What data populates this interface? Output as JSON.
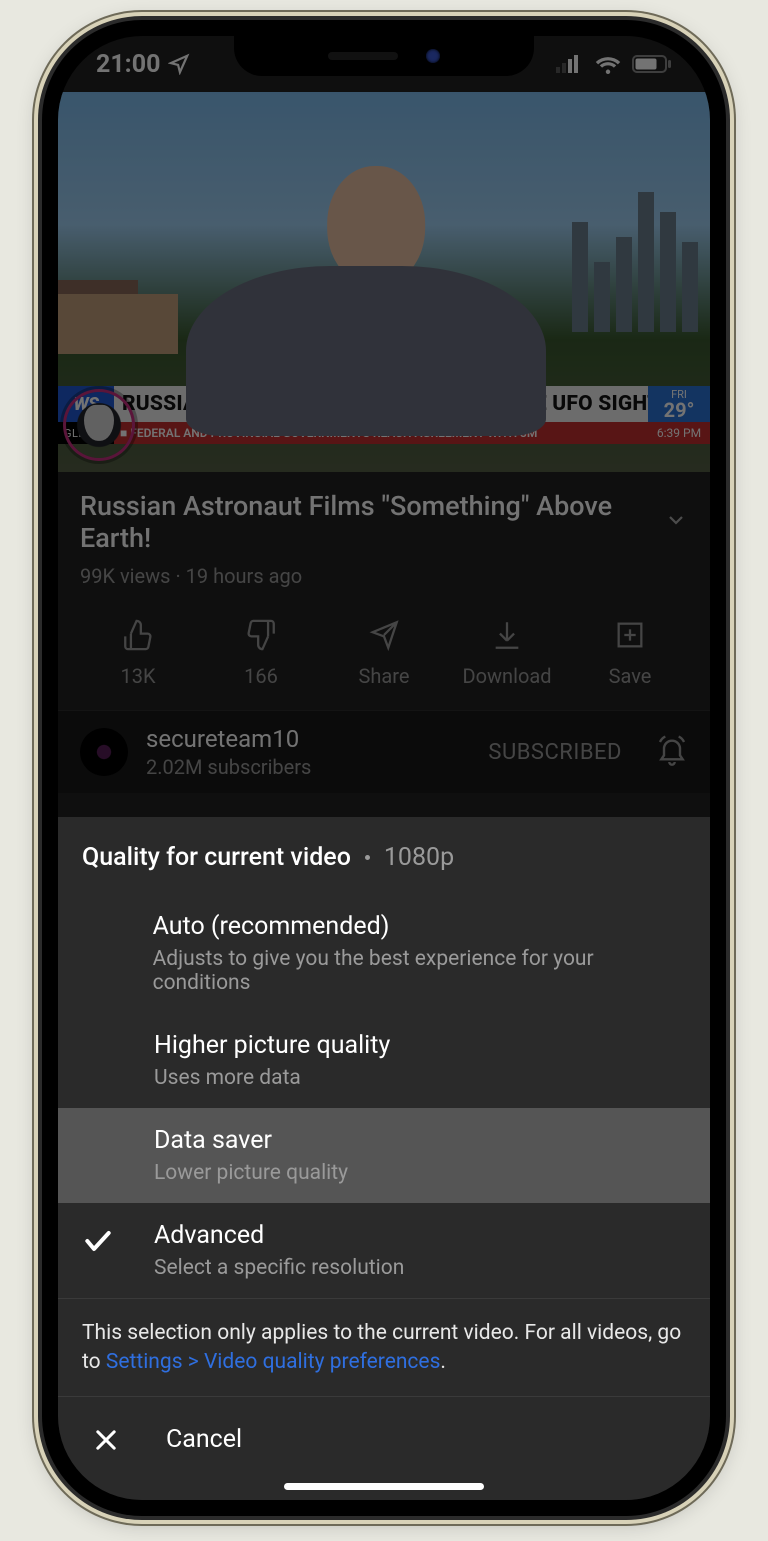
{
  "statusbar": {
    "time": "21:00"
  },
  "video": {
    "chyron": {
      "network_abbr": "WS",
      "headline": "RUSSIAN ASTRONAUT REPORTS POSSIBLE UFO SIGHTING",
      "day": "FRI",
      "temp": "29°",
      "glitch": "GLITCH.",
      "ticker": "■ FEDERAL AND PROVINCIAL GOVERNMENTS REACH AGREEMENT WITH 3M",
      "time": "6:39 PM"
    }
  },
  "meta": {
    "title": "Russian Astronaut Films \"Something\" Above Earth!",
    "views": "99K views",
    "sep": " · ",
    "age": "19 hours ago"
  },
  "actions": {
    "likes": "13K",
    "dislikes": "166",
    "share": "Share",
    "download": "Download",
    "save": "Save"
  },
  "channel": {
    "name": "secureteam10",
    "subs": "2.02M subscribers",
    "status": "SUBSCRIBED"
  },
  "sheet": {
    "title": "Quality for current video",
    "current": "1080p",
    "options": {
      "auto": {
        "name": "Auto (recommended)",
        "desc": "Adjusts to give you the best experience for your conditions"
      },
      "higher": {
        "name": "Higher picture quality",
        "desc": "Uses more data"
      },
      "saver": {
        "name": "Data saver",
        "desc": "Lower picture quality"
      },
      "advanced": {
        "name": "Advanced",
        "desc": "Select a specific resolution"
      }
    },
    "note_pre": "This selection only applies to the current video. For all videos, go to ",
    "note_link": "Settings > Video quality preferences",
    "note_post": ".",
    "cancel": "Cancel"
  }
}
